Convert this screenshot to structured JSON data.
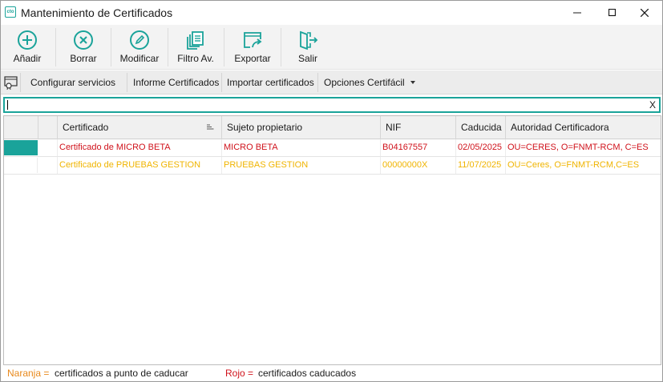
{
  "window": {
    "title": "Mantenimiento de Certificados",
    "app_icon_text": "cto"
  },
  "toolbar": {
    "add_label": "Añadir",
    "delete_label": "Borrar",
    "edit_label": "Modificar",
    "filter_label": "Filtro Av.",
    "export_label": "Exportar",
    "exit_label": "Salir",
    "accent": "#1aa39a"
  },
  "subbar": {
    "configure_label": "Configurar servicios",
    "report_label": "Informe Certificados",
    "import_label": "Importar certificados",
    "options_label": "Opciones Certifácil"
  },
  "search": {
    "value": "",
    "clear_label": "X"
  },
  "table": {
    "columns": [
      "Certificado",
      "Sujeto propietario",
      "NIF",
      "Caducida",
      "Autoridad Certificadora"
    ],
    "rows": [
      {
        "certificado": "Certificado de MICRO BETA",
        "sujeto": "MICRO BETA",
        "nif": "B04167557",
        "caducidad": "02/05/2025",
        "autoridad": "OU=CERES, O=FNMT-RCM, C=ES",
        "color": "#d0121b"
      },
      {
        "certificado": "Certificado de PRUEBAS GESTION",
        "sujeto": "PRUEBAS GESTION",
        "nif": "00000000X",
        "caducidad": "11/07/2025",
        "autoridad": "OU=Ceres, O=FNMT-RCM,C=ES",
        "color": "#f0b400"
      }
    ]
  },
  "legend": {
    "orange_key": "Naranja =",
    "orange_text": "certificados a punto de caducar",
    "red_key": "Rojo =",
    "red_text": "certificados caducados",
    "orange_color": "#e8891c",
    "red_color": "#d0121b"
  }
}
